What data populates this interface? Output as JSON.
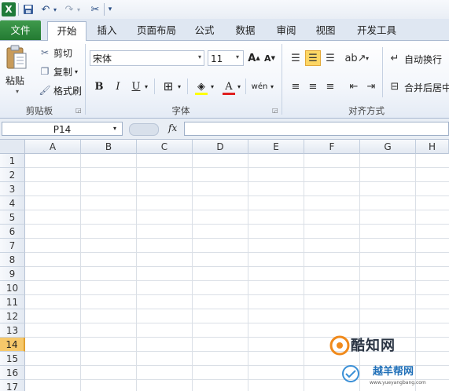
{
  "quick_access": {
    "logo": "X"
  },
  "tabs": [
    {
      "label": "文件"
    },
    {
      "label": "开始"
    },
    {
      "label": "插入"
    },
    {
      "label": "页面布局"
    },
    {
      "label": "公式"
    },
    {
      "label": "数据"
    },
    {
      "label": "审阅"
    },
    {
      "label": "视图"
    },
    {
      "label": "开发工具"
    }
  ],
  "clipboard": {
    "paste": "粘贴",
    "cut": "剪切",
    "copy": "复制",
    "format_painter": "格式刷",
    "label": "剪贴板"
  },
  "font": {
    "name": "宋体",
    "size": "11",
    "bold": "B",
    "italic": "I",
    "underline": "U",
    "font_color": "A",
    "grow": "A",
    "shrink": "A",
    "phonetic": "wén",
    "label": "字体",
    "fill_color": "#ffff00",
    "text_color": "#e02020"
  },
  "alignment": {
    "wrap_text": "自动换行",
    "merge": "合并后居中",
    "label": "对齐方式"
  },
  "formula_bar": {
    "name_box": "P14",
    "fx": "fx",
    "value": ""
  },
  "sheet": {
    "columns": [
      "A",
      "B",
      "C",
      "D",
      "E",
      "F",
      "G",
      "H"
    ],
    "rows": [
      "1",
      "2",
      "3",
      "4",
      "5",
      "6",
      "7",
      "8",
      "9",
      "10",
      "11",
      "12",
      "13",
      "14",
      "15",
      "16",
      "17"
    ],
    "active_row": "14"
  },
  "watermark": {
    "brand": "酷知网",
    "sub": "越羊帮网",
    "url": "www.yueyangbang.com"
  }
}
